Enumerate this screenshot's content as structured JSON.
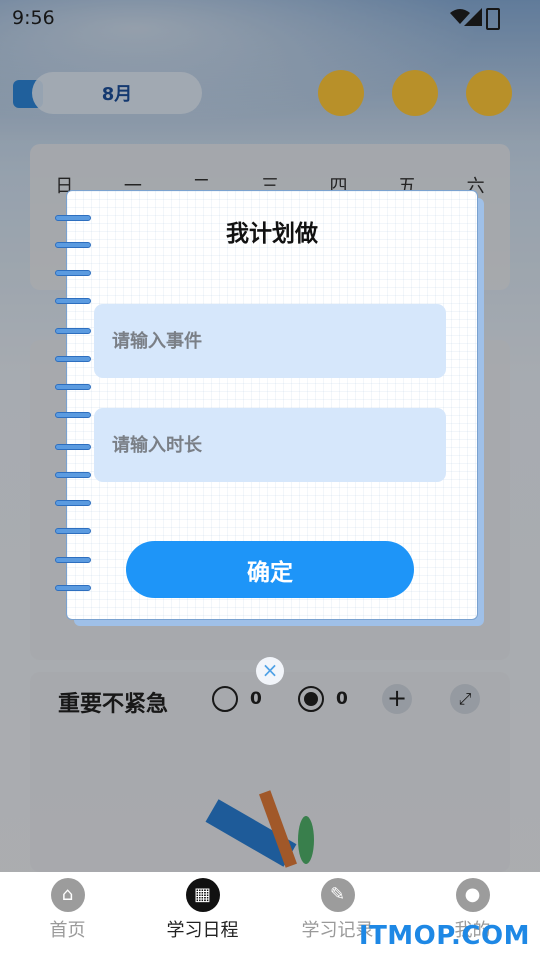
{
  "status_bar": {
    "time": "9:56"
  },
  "header": {
    "month_label": "8月"
  },
  "calendar": {
    "weekdays": [
      "日",
      "一",
      "二",
      "三",
      "四",
      "五",
      "六"
    ]
  },
  "quadrant": {
    "title": "重要不紧急",
    "unchecked_count": "0",
    "checked_count": "0",
    "add_label": "+",
    "expand_label": "⤢"
  },
  "dialog": {
    "title": "我计划做",
    "event_placeholder": "请输入事件",
    "duration_placeholder": "请输入时长",
    "confirm_label": "确定",
    "close_label": "×"
  },
  "bottom_nav": {
    "items": [
      {
        "label": "首页",
        "icon": "home-icon",
        "active": false
      },
      {
        "label": "学习日程",
        "icon": "calendar-icon",
        "active": true
      },
      {
        "label": "学习记录",
        "icon": "record-icon",
        "active": false
      },
      {
        "label": "我的",
        "icon": "profile-icon",
        "active": false
      }
    ]
  },
  "watermark": "ITMOP.COM",
  "colors": {
    "accent": "#1e95f8",
    "field_bg": "#d6e7fb",
    "month_text": "#1d4f9b"
  }
}
